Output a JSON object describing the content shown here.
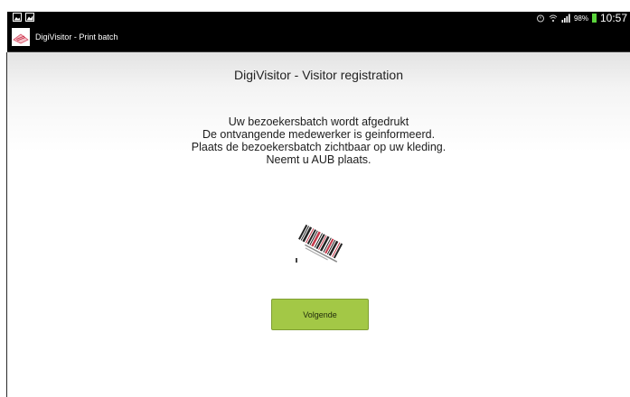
{
  "status_bar": {
    "battery_percent": "98%",
    "time": "10:57",
    "battery_color": "#5bd53c"
  },
  "action_bar": {
    "title": "DigiVisitor - Print batch"
  },
  "main": {
    "heading": "DigiVisitor - Visitor registration",
    "message_lines": [
      "Uw bezoekersbatch wordt afgedrukt",
      "De ontvangende medewerker is geinformeerd.",
      "Plaats de bezoekersbatch zichtbaar op uw kleding.",
      "Neemt u AUB plaats."
    ],
    "barcode_icon": "barcode-icon",
    "next_button_label": "Volgende",
    "next_button_color": "#a3c846"
  }
}
